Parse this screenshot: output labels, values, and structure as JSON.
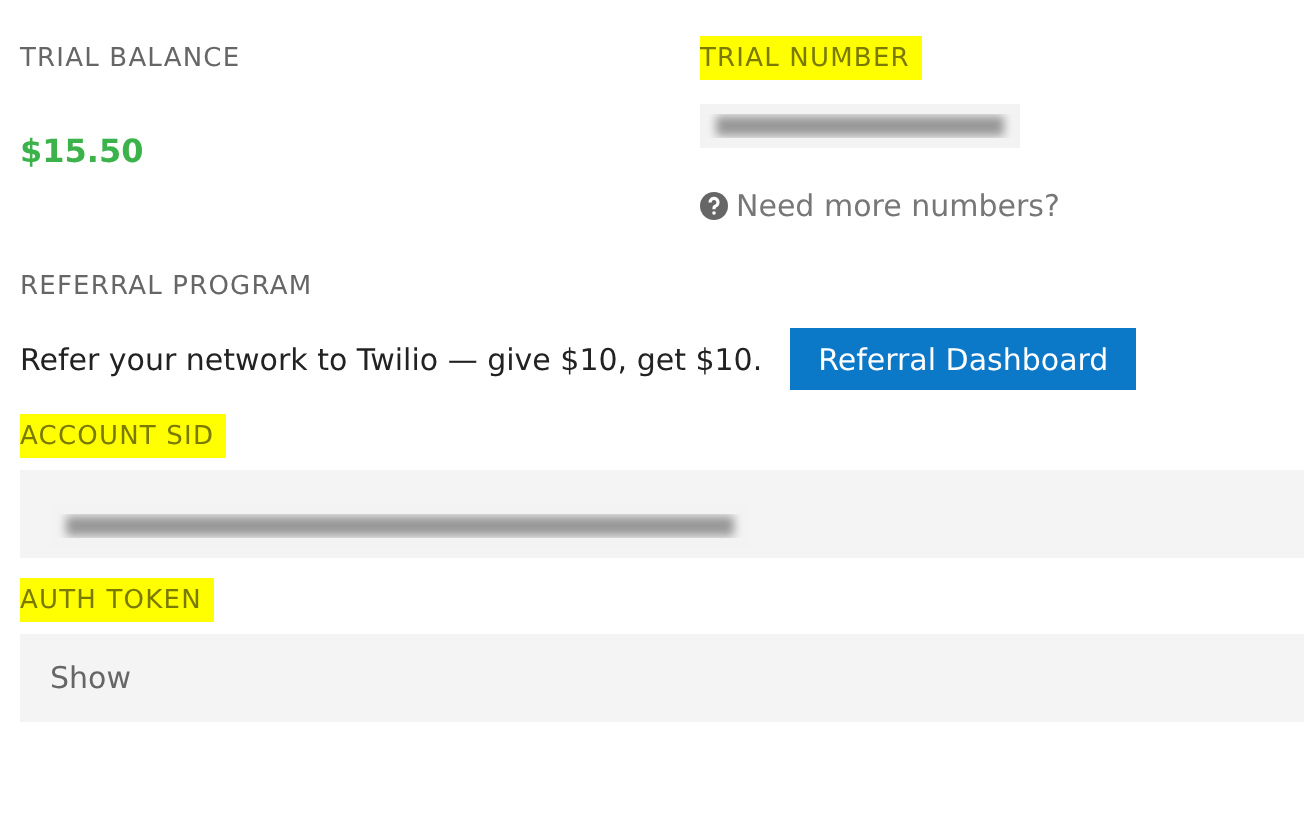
{
  "trial_balance": {
    "label": "TRIAL BALANCE",
    "highlighted": false,
    "value": "$15.50"
  },
  "trial_number": {
    "label": "TRIAL NUMBER",
    "highlighted": true,
    "redacted": true,
    "help_link": "Need more numbers?"
  },
  "referral": {
    "label": "REFERRAL PROGRAM",
    "highlighted": false,
    "text": "Refer your network to Twilio — give $10, get $10.",
    "button": "Referral Dashboard"
  },
  "account_sid": {
    "label": "ACCOUNT SID",
    "highlighted": true,
    "redacted": true
  },
  "auth_token": {
    "label": "AUTH TOKEN",
    "highlighted": true,
    "value": "Show"
  }
}
